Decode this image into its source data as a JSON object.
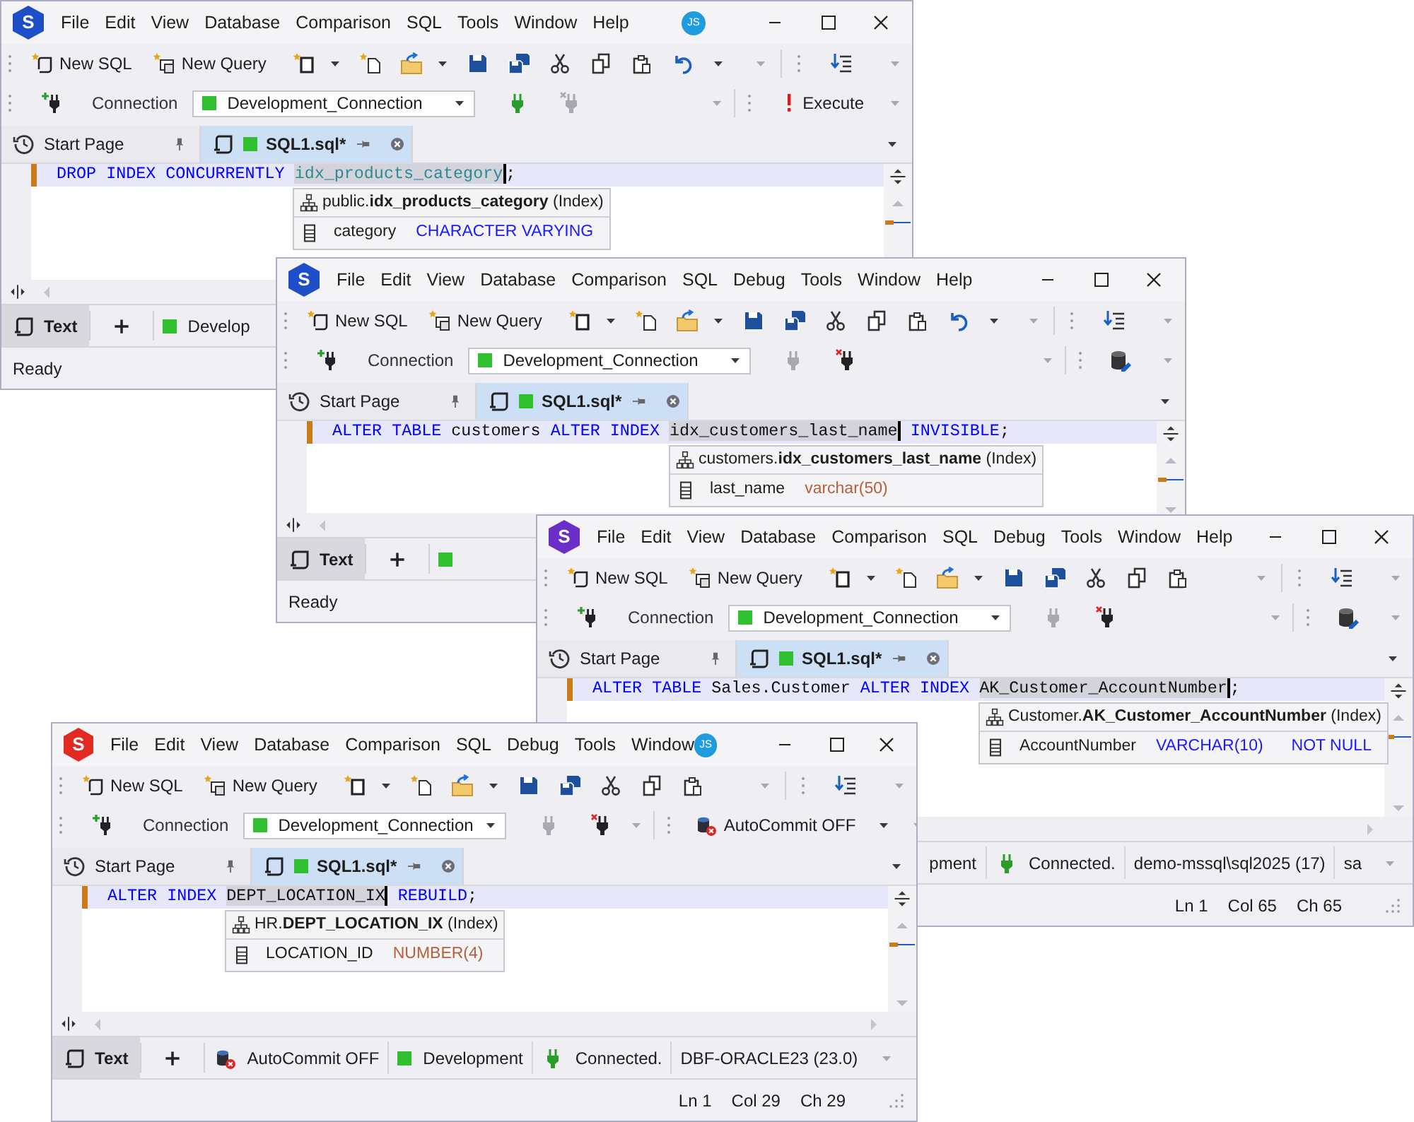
{
  "windows": [
    {
      "logo": {
        "letter": "S",
        "color": "#1f4fc8"
      },
      "menu": [
        "File",
        "Edit",
        "View",
        "Database",
        "Comparison",
        "SQL",
        "Tools",
        "Window",
        "Help"
      ],
      "avatar": "JS",
      "toolbar": {
        "buttons": [
          "New SQL",
          "New Query"
        ]
      },
      "connection": {
        "label": "Connection",
        "value": "Development_Connection",
        "color": "#2fbf2f",
        "connected": false
      },
      "toolbar_right": {
        "kind": "execute",
        "label": "Execute"
      },
      "tabs": [
        {
          "label": "Start Page",
          "selected": false
        },
        {
          "label": "SQL1.sql*",
          "selected": true
        }
      ],
      "code": [
        {
          "text": "DROP INDEX CONCURRENTLY ",
          "kind": "keyword"
        },
        {
          "text": "idx_products_category",
          "kind": "object_highlight"
        },
        {
          "text": ";",
          "kind": "punct"
        }
      ],
      "popup": {
        "title": "public.**idx_products_category** (Index)",
        "columns": [
          {
            "name": "category",
            "type": "CHARACTER VARYING",
            "color": "#1a1aff"
          }
        ]
      },
      "bottom_tabs": [
        {
          "label": "Text",
          "selected": true
        }
      ],
      "status_items": [
        {
          "kind": "connection",
          "text": "Develop"
        }
      ],
      "status": {
        "text": "Ready"
      }
    },
    {
      "logo": {
        "letter": "S",
        "color": "#1f4fc8"
      },
      "menu": [
        "File",
        "Edit",
        "View",
        "Database",
        "Comparison",
        "SQL",
        "Debug",
        "Tools",
        "Window",
        "Help"
      ],
      "toolbar": {
        "buttons": [
          "New SQL",
          "New Query"
        ]
      },
      "connection": {
        "label": "Connection",
        "value": "Development_Connection",
        "color": "#2fbf2f",
        "connected": true
      },
      "toolbar_right": {
        "kind": "db_edit"
      },
      "tabs": [
        {
          "label": "Start Page",
          "selected": false
        },
        {
          "label": "SQL1.sql*",
          "selected": true
        }
      ],
      "code": [
        {
          "text": "ALTER TABLE ",
          "kind": "keyword"
        },
        {
          "text": "customers ",
          "kind": "identifier"
        },
        {
          "text": "ALTER INDEX ",
          "kind": "keyword"
        },
        {
          "text": "idx_customers_last_name",
          "kind": "highlight"
        },
        {
          "text": " INVISIBLE",
          "kind": "keyword"
        },
        {
          "text": ";",
          "kind": "punct"
        }
      ],
      "popup": {
        "title": "customers.**idx_customers_last_name** (Index)",
        "columns": [
          {
            "name": "last_name",
            "type": "varchar(50)",
            "color": "#b5603a"
          }
        ]
      },
      "bottom_tabs": [
        {
          "label": "Text",
          "selected": true
        }
      ],
      "status_items": [
        {
          "kind": "connection"
        }
      ],
      "status": {
        "text": "Ready"
      }
    },
    {
      "logo": {
        "letter": "S",
        "color": "#6a2fc8"
      },
      "menu": [
        "File",
        "Edit",
        "View",
        "Database",
        "Comparison",
        "SQL",
        "Debug",
        "Tools",
        "Window",
        "Help"
      ],
      "toolbar": {
        "buttons": [
          "New SQL",
          "New Query"
        ]
      },
      "connection": {
        "label": "Connection",
        "value": "Development_Connection",
        "color": "#2fbf2f",
        "connected": true
      },
      "toolbar_right": {
        "kind": "db_edit"
      },
      "tabs": [
        {
          "label": "Start Page",
          "selected": false
        },
        {
          "label": "SQL1.sql*",
          "selected": true
        }
      ],
      "code": [
        {
          "text": "ALTER TABLE ",
          "kind": "keyword"
        },
        {
          "text": "Sales.Customer ",
          "kind": "identifier"
        },
        {
          "text": "ALTER INDEX ",
          "kind": "keyword"
        },
        {
          "text": "AK_Customer_AccountNumber",
          "kind": "highlight"
        },
        {
          "text": ";",
          "kind": "punct"
        }
      ],
      "popup": {
        "title": "Customer.**AK_Customer_AccountNumber** (Index)",
        "columns": [
          {
            "name": "AccountNumber",
            "type": "VARCHAR(10)",
            "color": "#1a1aff",
            "constraint": "NOT NULL"
          }
        ]
      },
      "status_items": [
        {
          "kind": "plain",
          "text": "pment"
        },
        {
          "kind": "connected",
          "text": "Connected."
        },
        {
          "kind": "server",
          "text": "demo-mssql\\sql2025 (17)"
        },
        {
          "kind": "user",
          "text": "sa"
        }
      ],
      "status": {
        "position": [
          "Ln 1",
          "Col 65",
          "Ch 65"
        ]
      }
    },
    {
      "logo": {
        "letter": "S",
        "color": "#e02a22"
      },
      "menu": [
        "File",
        "Edit",
        "View",
        "Database",
        "Comparison",
        "SQL",
        "Debug",
        "Tools",
        "Window"
      ],
      "avatar": "JS",
      "toolbar": {
        "buttons": [
          "New SQL",
          "New Query"
        ]
      },
      "connection": {
        "label": "Connection",
        "value": "Development_Connection",
        "color": "#2fbf2f",
        "connected": true
      },
      "toolbar_right": {
        "kind": "autocommit",
        "label": "AutoCommit OFF"
      },
      "tabs": [
        {
          "label": "Start Page",
          "selected": false
        },
        {
          "label": "SQL1.sql*",
          "selected": true
        }
      ],
      "code": [
        {
          "text": "ALTER INDEX ",
          "kind": "keyword"
        },
        {
          "text": "DEPT_LOCATION_IX",
          "kind": "highlight"
        },
        {
          "text": " REBUILD",
          "kind": "keyword"
        },
        {
          "text": ";",
          "kind": "punct"
        }
      ],
      "popup": {
        "title": "HR.**DEPT_LOCATION_IX** (Index)",
        "columns": [
          {
            "name": "LOCATION_ID",
            "type": "NUMBER(4)",
            "color": "#b5603a"
          }
        ]
      },
      "bottom_tabs": [
        {
          "label": "Text",
          "selected": true
        }
      ],
      "status_items": [
        {
          "kind": "autocommit",
          "text": "AutoCommit OFF"
        },
        {
          "kind": "connection",
          "text": "Development"
        },
        {
          "kind": "connected",
          "text": "Connected."
        },
        {
          "kind": "server",
          "text": "DBF-ORACLE23 (23.0)"
        }
      ],
      "status": {
        "position": [
          "Ln 1",
          "Col 29",
          "Ch 29"
        ]
      }
    }
  ]
}
